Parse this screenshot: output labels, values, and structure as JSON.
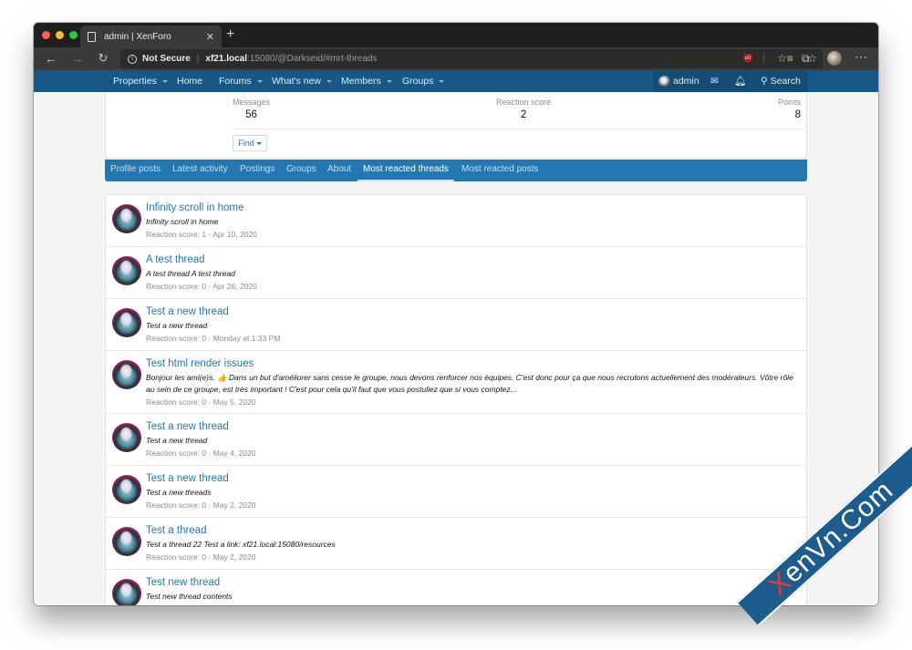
{
  "browser": {
    "tab_title": "admin | XenForo",
    "tab_close_icon": "close-icon",
    "new_tab_label": "+",
    "security_label": "Not Secure",
    "url_host": "xf21.local",
    "url_path": ":15080/@Darkseid/#mrt-threads",
    "more_label": "⋯"
  },
  "nav": {
    "items": [
      {
        "label": "Properties",
        "has_menu": true
      },
      {
        "label": "Home",
        "has_menu": false
      },
      {
        "label": "Forums",
        "has_menu": true
      },
      {
        "label": "What's new",
        "has_menu": true
      },
      {
        "label": "Members",
        "has_menu": true
      },
      {
        "label": "Groups",
        "has_menu": true
      }
    ],
    "user_label": "admin",
    "search_label": "Search"
  },
  "profile": {
    "stats": [
      {
        "label": "Messages",
        "value": "56"
      },
      {
        "label": "Reaction score",
        "value": "2"
      },
      {
        "label": "Points",
        "value": "8"
      }
    ],
    "find_label": "Find"
  },
  "tabs": [
    {
      "label": "Profile posts",
      "active": false
    },
    {
      "label": "Latest activity",
      "active": false
    },
    {
      "label": "Postings",
      "active": false
    },
    {
      "label": "Groups",
      "active": false
    },
    {
      "label": "About",
      "active": false
    },
    {
      "label": "Most reacted threads",
      "active": true
    },
    {
      "label": "Most reacted posts",
      "active": false
    }
  ],
  "threads": [
    {
      "title": "Infinity scroll in home",
      "snippet": "Infinity scroll in home",
      "meta": "Reaction score: 1 · Apr 10, 2020"
    },
    {
      "title": "A test thread",
      "snippet": "A test thread A test thread",
      "meta": "Reaction score: 0 · Apr 26, 2020"
    },
    {
      "title": "Test a new thread",
      "snippet": "Test a new thread",
      "meta": "Reaction score: 0 · Monday at 1:33 PM"
    },
    {
      "title": "Test html render issues",
      "snippet": "Bonjour les ami(e)s, 👍 Dans un but d'améliorer sans cesse le groupe, nous devons renforcer nos équipes. C'est donc pour ça que nous recrutons actuellement des modérateurs. Vôtre rôle au sein de ce groupe, est très important ! C'est pour cela qu'il faut que vous postuliez que si vous comptez...",
      "meta": "Reaction score: 0 · May 5, 2020"
    },
    {
      "title": "Test a new thread",
      "snippet": "Test a new thread",
      "meta": "Reaction score: 0 · May 4, 2020"
    },
    {
      "title": "Test a new thread",
      "snippet": "Test a new threads",
      "meta": "Reaction score: 0 · May 2, 2020"
    },
    {
      "title": "Test a thread",
      "snippet": "Test a thread 22 Test a link: xf21.local:15080/resources",
      "meta": "Reaction score: 0 · May 2, 2020"
    },
    {
      "title": "Test new thread",
      "snippet": "Test new thread contents",
      "meta": ""
    }
  ],
  "watermark": {
    "x": "X",
    "text": "enVn.Com"
  },
  "colors": {
    "nav": "#185886",
    "tabs": "#2577b1",
    "link": "#2577b1"
  }
}
